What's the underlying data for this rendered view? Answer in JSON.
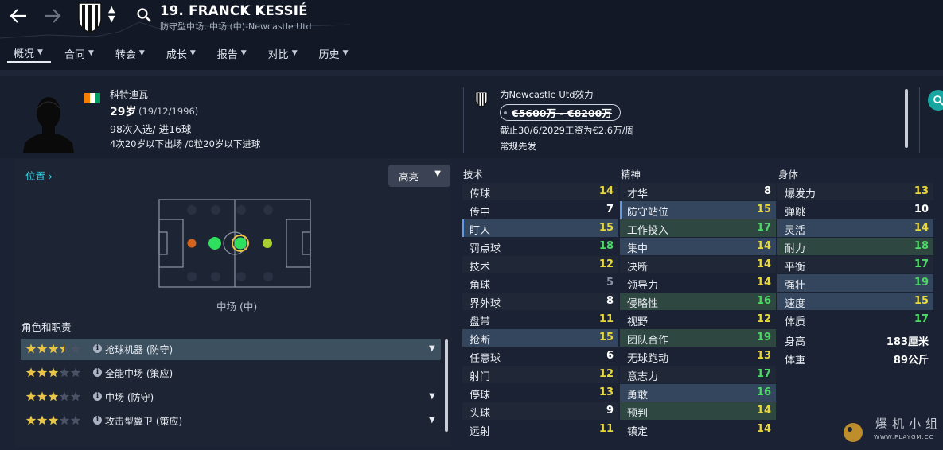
{
  "header": {
    "back_icon": "back-arrow-icon",
    "forward_icon": "forward-arrow-icon",
    "player_name": "19. FRANCK KESSIÉ",
    "player_subtitle": "防守型中场, 中场 (中)-Newcastle Utd"
  },
  "tabs": [
    {
      "label": "概况",
      "active": true
    },
    {
      "label": "合同"
    },
    {
      "label": "转会"
    },
    {
      "label": "成长"
    },
    {
      "label": "报告"
    },
    {
      "label": "对比"
    },
    {
      "label": "历史"
    }
  ],
  "profile": {
    "nationality": "科特迪瓦",
    "flag_colors": [
      "#f77f00",
      "#ffffff",
      "#009e60"
    ],
    "age": "29岁",
    "dob": "(19/12/1996)",
    "caps": "98次入选/ 进16球",
    "youth": "4次20岁以下出场 /0粒20岁以下进球"
  },
  "club": {
    "plays_for": "为Newcastle Utd效力",
    "value": "€5600万 - €8200万",
    "contract": "截止30/6/2029工资为€2.6万/周",
    "status": "常规先发"
  },
  "position_panel": {
    "link": "位置",
    "dropdown": "高亮",
    "position_label": "中场 (中)",
    "roles_title": "角色和职责",
    "roles": [
      {
        "name": "抢球机器 (防守)",
        "stars": 3.5
      },
      {
        "name": "全能中场 (策应)",
        "stars": 3
      },
      {
        "name": "中场 (防守)",
        "stars": 3
      },
      {
        "name": "攻击型翼卫 (策应)",
        "stars": 3
      }
    ]
  },
  "attributes": {
    "technical_title": "技术",
    "mental_title": "精神",
    "physical_title": "身体",
    "technical": [
      {
        "name": "传球",
        "value": "14"
      },
      {
        "name": "传中",
        "value": "7"
      },
      {
        "name": "盯人",
        "value": "15"
      },
      {
        "name": "罚点球",
        "value": "18"
      },
      {
        "name": "技术",
        "value": "12"
      },
      {
        "name": "角球",
        "value": "5"
      },
      {
        "name": "界外球",
        "value": "8"
      },
      {
        "name": "盘带",
        "value": "11"
      },
      {
        "name": "抢断",
        "value": "15"
      },
      {
        "name": "任意球",
        "value": "6"
      },
      {
        "name": "射门",
        "value": "12"
      },
      {
        "name": "停球",
        "value": "13"
      },
      {
        "name": "头球",
        "value": "9"
      },
      {
        "name": "远射",
        "value": "11"
      }
    ],
    "mental": [
      {
        "name": "才华",
        "value": "8"
      },
      {
        "name": "防守站位",
        "value": "15"
      },
      {
        "name": "工作投入",
        "value": "17"
      },
      {
        "name": "集中",
        "value": "14"
      },
      {
        "name": "决断",
        "value": "14"
      },
      {
        "name": "领导力",
        "value": "14"
      },
      {
        "name": "侵略性",
        "value": "16"
      },
      {
        "name": "视野",
        "value": "12"
      },
      {
        "name": "团队合作",
        "value": "19"
      },
      {
        "name": "无球跑动",
        "value": "13"
      },
      {
        "name": "意志力",
        "value": "17"
      },
      {
        "name": "勇敢",
        "value": "16"
      },
      {
        "name": "预判",
        "value": "14"
      },
      {
        "name": "镇定",
        "value": "14"
      }
    ],
    "physical": [
      {
        "name": "爆发力",
        "value": "13"
      },
      {
        "name": "弹跳",
        "value": "10"
      },
      {
        "name": "灵活",
        "value": "14"
      },
      {
        "name": "耐力",
        "value": "18"
      },
      {
        "name": "平衡",
        "value": "17"
      },
      {
        "name": "强壮",
        "value": "19"
      },
      {
        "name": "速度",
        "value": "15"
      },
      {
        "name": "体质",
        "value": "17"
      }
    ],
    "height_label": "身高",
    "height": "183厘米",
    "weight_label": "体重",
    "weight": "89公斤"
  },
  "colors": {
    "white": "#ffffff",
    "yellow": "#e8d83a",
    "green": "#4cd964",
    "gray": "#8a93a3",
    "teal": "#2fd4e6",
    "star": "#e8c447"
  },
  "watermark": {
    "text": "爆机小组",
    "sub": "WWW.PLAYGM.CC"
  }
}
